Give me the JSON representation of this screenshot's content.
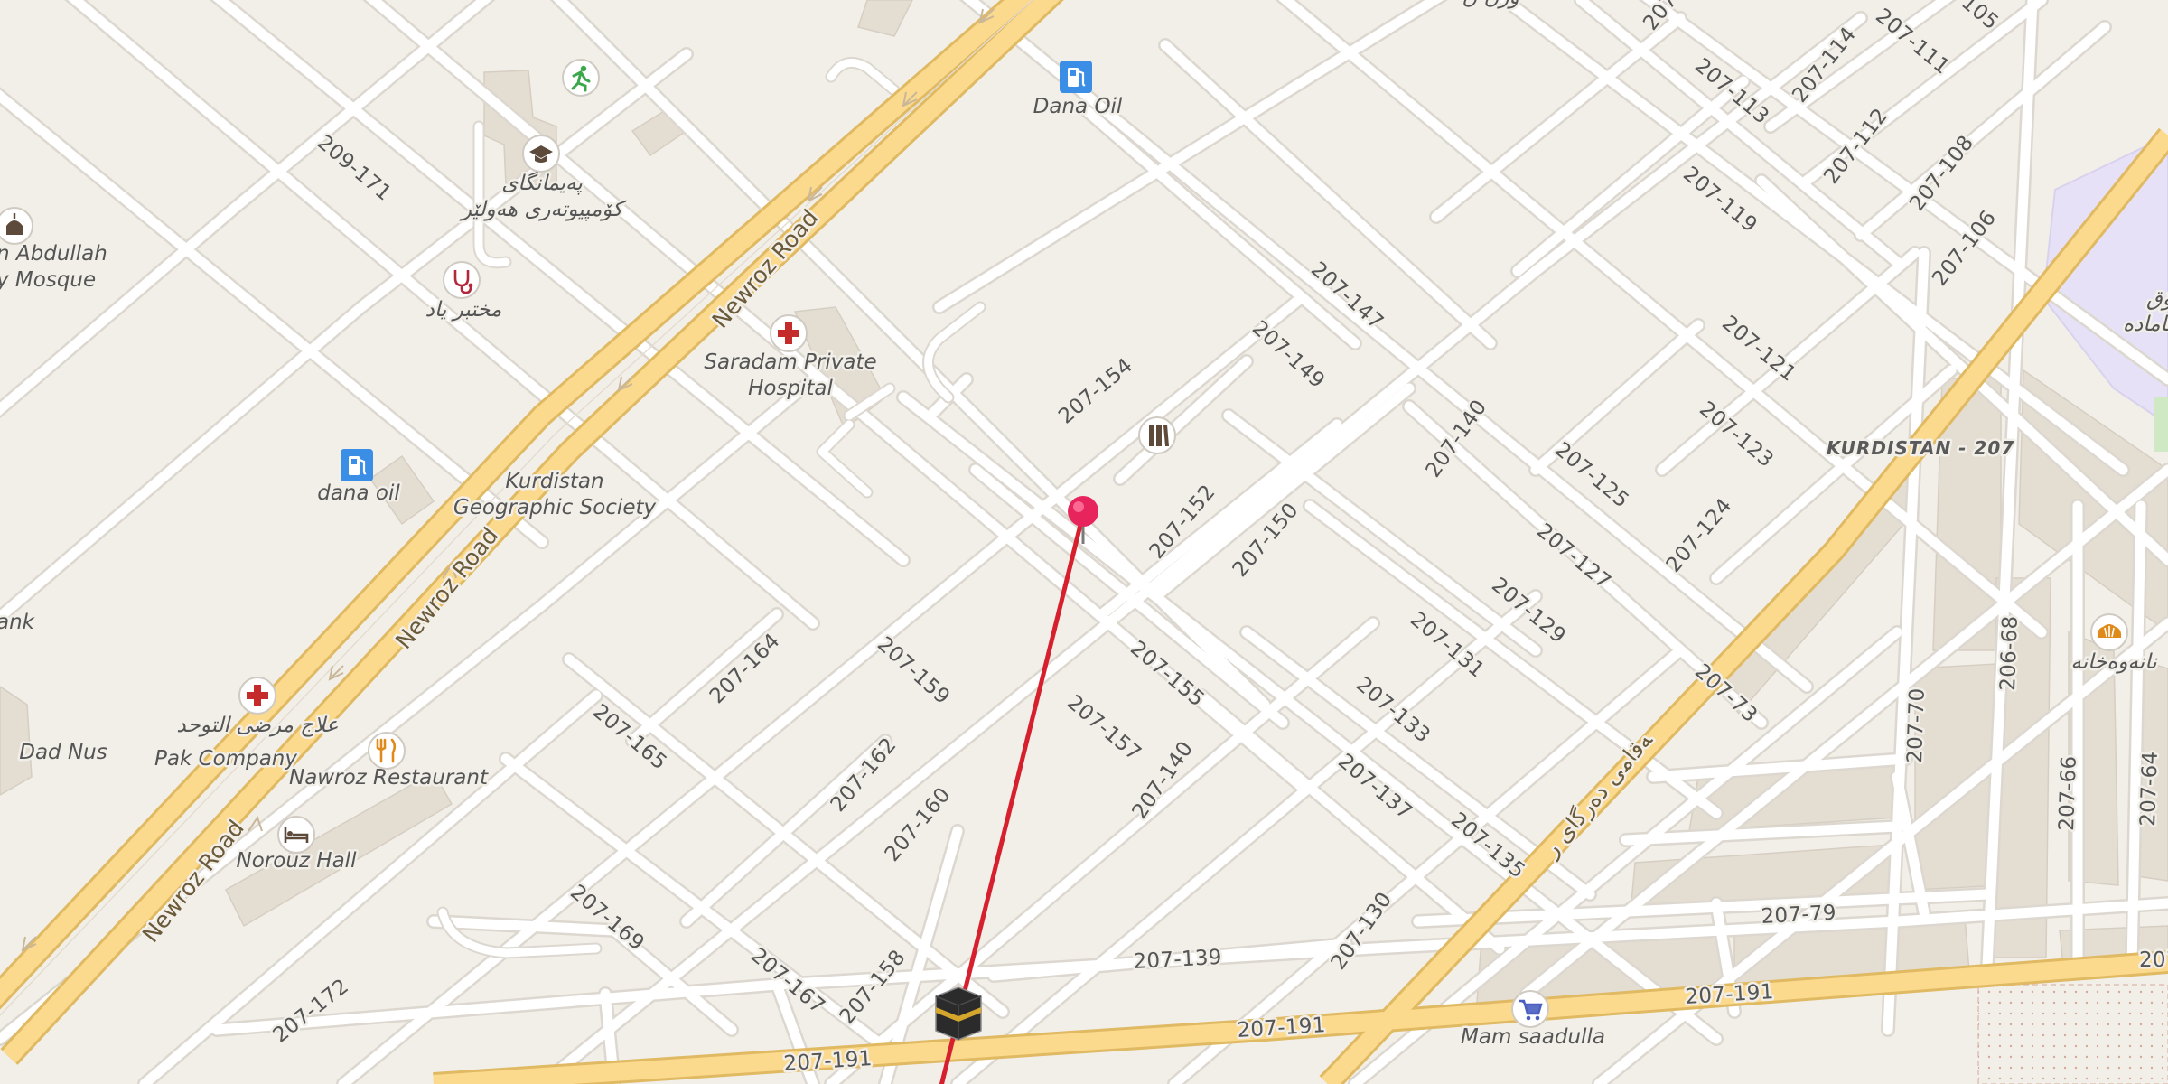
{
  "map": {
    "colors": {
      "land": "#f2efe9",
      "road": "#ffffff",
      "road_edge": "#dcd7cf",
      "major_fill": "#fbd98d",
      "major_edge": "#e0b963",
      "route": "#d7202e",
      "pin": "#e8245c",
      "campus": "#e6e1f6"
    },
    "main_roads": [
      {
        "id": "newroz-1",
        "label": "Newroz Road"
      },
      {
        "id": "newroz-2",
        "label": "Newroz Road"
      },
      {
        "id": "newroz-3",
        "label": "Newroz Road"
      },
      {
        "id": "road-191-a",
        "label": "207-191"
      },
      {
        "id": "road-191-b",
        "label": "207-191"
      },
      {
        "id": "road-191-c",
        "label": "207-191"
      },
      {
        "id": "road-rtl",
        "label": "شەقامی دەرگای ر"
      }
    ],
    "street_labels": [
      "209-171",
      "207-154",
      "207-152",
      "207-150",
      "207-149",
      "207-147",
      "207-140",
      "207-140",
      "207-155",
      "207-157",
      "207-164",
      "207-165",
      "207-159",
      "207-162",
      "207-160",
      "207-158",
      "207-167",
      "207-169",
      "207-172",
      "207-139",
      "207-130",
      "207-137",
      "207-135",
      "207-133",
      "207-131",
      "207-129",
      "207-127",
      "207-125",
      "207-124",
      "207-123",
      "207-121",
      "207-119",
      "207-113",
      "207-114",
      "207-111",
      "207-112",
      "207-108",
      "207-106",
      "207-73",
      "207-79",
      "207-70",
      "206-68",
      "207-66",
      "207-64",
      "207-",
      "207-1",
      "105"
    ],
    "district_label": "KURDISTAN - 207",
    "pois": [
      {
        "id": "dana-oil-top",
        "label": "Dana Oil",
        "icon": "fuel-icon"
      },
      {
        "id": "dana-oil-left",
        "label": "dana oil",
        "icon": "fuel-icon"
      },
      {
        "id": "computer-institute",
        "label_line1": "پەیمانگای",
        "label_line2": "کۆمپیوتەری ھەولێر",
        "icon": "graduation-cap-icon"
      },
      {
        "id": "lab",
        "label": "مختبر ياد",
        "icon": "stethoscope-icon"
      },
      {
        "id": "sports",
        "label": "",
        "icon": "running-icon"
      },
      {
        "id": "saradam-hospital",
        "label_line1": "Saradam Private",
        "label_line2": "Hospital",
        "icon": "hospital-cross-icon"
      },
      {
        "id": "geographic-society",
        "label_line1": "Kurdistan",
        "label_line2": "Geographic Society",
        "icon": ""
      },
      {
        "id": "mosque",
        "label_line1": "n Abdullah",
        "label_line2": "y Mosque",
        "icon": "mosque-icon"
      },
      {
        "id": "bank",
        "label": "ank",
        "icon": ""
      },
      {
        "id": "clinic-ar",
        "label": "علاج مرضى التوحد",
        "icon": "hospital-cross-icon"
      },
      {
        "id": "pak-company",
        "label": "Pak Company",
        "icon": ""
      },
      {
        "id": "nawroz-restaurant",
        "label": "Nawroz Restaurant",
        "icon": "restaurant-icon"
      },
      {
        "id": "dad-nus",
        "label": "Dad Nus",
        "icon": ""
      },
      {
        "id": "norouz-hall",
        "label": "Norouz Hall",
        "icon": "bed-icon"
      },
      {
        "id": "mam-saadulla",
        "label": "Mam saadulla",
        "icon": "shopping-cart-icon"
      },
      {
        "id": "bakery",
        "label": "نانەوەخانە",
        "icon": "bakery-icon"
      },
      {
        "id": "campus",
        "label_line1": "ۆق",
        "label_line2": "ئامادە",
        "icon": ""
      },
      {
        "id": "top-rtl",
        "label": "ورن ن",
        "icon": ""
      },
      {
        "id": "library",
        "label": "",
        "icon": "books-icon"
      }
    ],
    "markers": {
      "pin": "selected-location-pin",
      "kaaba": "qibla-kaaba-icon",
      "route_line": "qibla-direction-line"
    }
  }
}
